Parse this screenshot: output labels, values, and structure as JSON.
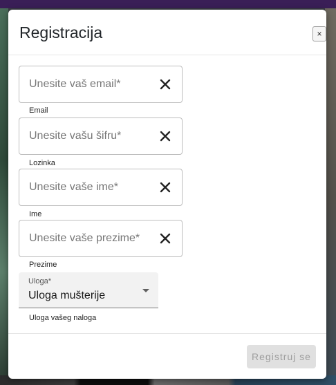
{
  "modal": {
    "title": "Registracija",
    "close_label": "×"
  },
  "fields": [
    {
      "placeholder": "Unesite vaš email*",
      "value": "",
      "helper": "Email",
      "clear_icon": "close-icon"
    },
    {
      "placeholder": "Unesite vašu šifru*",
      "value": "",
      "helper": "Lozinka",
      "clear_icon": "close-icon"
    },
    {
      "placeholder": "Unesite vaše ime*",
      "value": "",
      "helper": "Ime",
      "clear_icon": "close-icon"
    },
    {
      "placeholder": "Unesite vaše prezime*",
      "value": "",
      "helper": "Prezime",
      "clear_icon": "close-icon"
    }
  ],
  "role_select": {
    "label": "Uloga*",
    "value": "Uloga mušterije",
    "helper": "Uloga vašeg naloga"
  },
  "footer": {
    "submit_label": "Registruj se"
  },
  "colors": {
    "primary_text": "#212529",
    "disabled_button_bg": "#e0e0e0",
    "disabled_button_text": "#9e9e9e"
  }
}
